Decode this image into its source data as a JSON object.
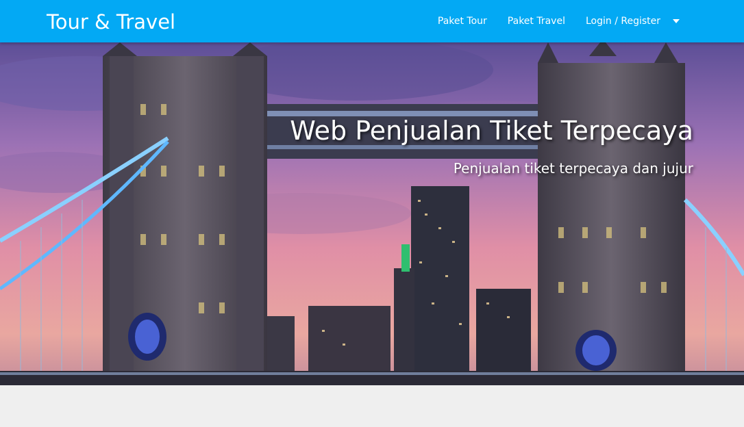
{
  "navbar": {
    "brand": "Tour & Travel",
    "links": [
      {
        "label": "Paket Tour"
      },
      {
        "label": "Paket Travel"
      },
      {
        "label": "Login / Register"
      }
    ],
    "bg_color": "#03a9f4"
  },
  "hero": {
    "title": "Web Penjualan Tiket Terpecaya",
    "subtitle": "Penjualan tiket terpecaya dan jujur",
    "image": "tower-bridge-london-sunset"
  },
  "icons": {
    "dropdown": "caret-down-icon"
  }
}
